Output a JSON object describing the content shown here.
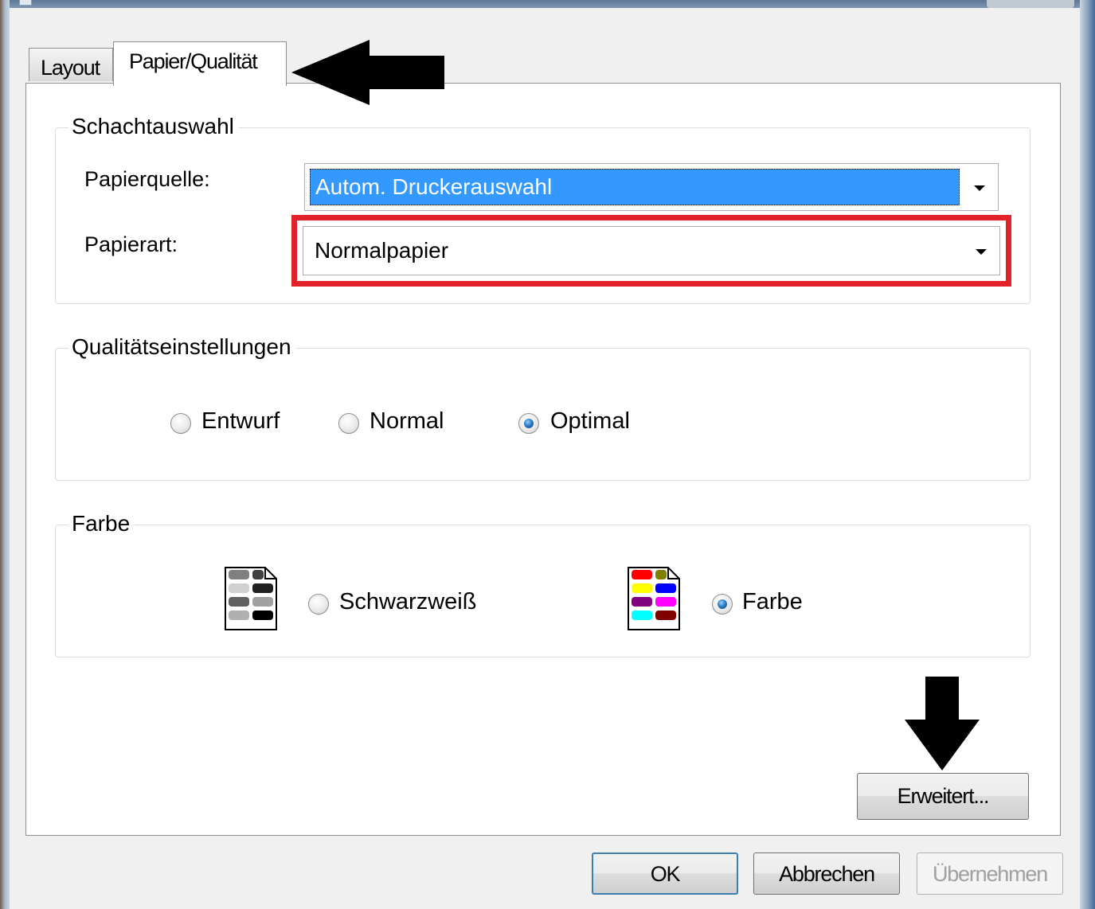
{
  "tabs": [
    {
      "label": "Layout",
      "active": false
    },
    {
      "label": "Papier/Qualität",
      "active": true
    }
  ],
  "tray_group": {
    "title": "Schachtauswahl",
    "paper_source": {
      "label": "Papierquelle:",
      "value": "Autom. Druckerauswahl"
    },
    "paper_type": {
      "label": "Papierart:",
      "value": "Normalpapier"
    }
  },
  "quality_group": {
    "title": "Qualitätseinstellungen",
    "options": [
      {
        "label": "Entwurf",
        "checked": false
      },
      {
        "label": "Normal",
        "checked": false
      },
      {
        "label": "Optimal",
        "checked": true
      }
    ]
  },
  "color_group": {
    "title": "Farbe",
    "options": [
      {
        "label": "Schwarzweiß",
        "checked": false,
        "icon": "grayscale-document-icon"
      },
      {
        "label": "Farbe",
        "checked": true,
        "icon": "color-document-icon"
      }
    ]
  },
  "advanced_button": {
    "label": "Erweitert..."
  },
  "footer": {
    "ok_label": "OK",
    "cancel_label": "Abbrechen",
    "apply_label": "Übernehmen",
    "apply_enabled": false
  },
  "colors": {
    "selection": "#3399ff",
    "highlight_box": "#e3212a",
    "annotation_arrow": "#000000"
  }
}
